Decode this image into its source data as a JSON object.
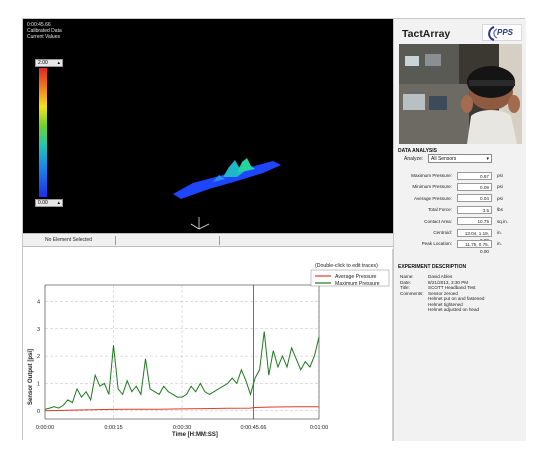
{
  "view3d": {
    "info_lines": [
      "0:00:45.66",
      "Calibrated Data",
      "Current Values"
    ],
    "scale_max": "2.00",
    "scale_min": "0.00"
  },
  "statusbar": {
    "selection": "No Element Selected"
  },
  "graph": {
    "edit_hint": "(Double-click to edit traces)",
    "legend": [
      {
        "name": "Average Pressure",
        "color": "#e03a2e"
      },
      {
        "name": "Maximum Pressure",
        "color": "#1e7a1e"
      }
    ],
    "y_label": "Sensor Output [psi]",
    "x_label": "Time [H:MM:SS]",
    "y_ticks": [
      "0",
      "1",
      "2",
      "3",
      "4"
    ],
    "x_ticks": [
      "0:00:00",
      "0:00:15",
      "0:00:30",
      "0:00:45.66",
      "0:01:00"
    ]
  },
  "chart_data": {
    "type": "line",
    "xlabel": "Time [H:MM:SS]",
    "ylabel": "Sensor Output [psi]",
    "xlim": [
      0,
      60
    ],
    "ylim": [
      -0.3,
      4.6
    ],
    "cursor_x": 45.66,
    "x_ticks": [
      0,
      15,
      30,
      45.66,
      60
    ],
    "y_ticks": [
      0,
      1,
      2,
      3,
      4
    ],
    "grid": true,
    "legend_position": "top-right",
    "series": [
      {
        "name": "Average Pressure",
        "color": "#e03a2e",
        "x": [
          0,
          5,
          10,
          15,
          20,
          25,
          30,
          35,
          40,
          45,
          46,
          50,
          55,
          60
        ],
        "y": [
          0,
          0.02,
          0.04,
          0.05,
          0.06,
          0.06,
          0.07,
          0.08,
          0.09,
          0.1,
          0.12,
          0.14,
          0.15,
          0.15
        ]
      },
      {
        "name": "Maximum Pressure",
        "color": "#1e7a1e",
        "x": [
          0,
          1,
          2,
          3,
          4,
          5,
          6,
          7,
          8,
          9,
          10,
          11,
          12,
          13,
          14,
          15,
          16,
          17,
          18,
          19,
          20,
          21,
          22,
          23,
          24,
          25,
          26,
          27,
          28,
          29,
          30,
          31,
          32,
          33,
          34,
          35,
          36,
          37,
          38,
          39,
          40,
          41,
          42,
          43,
          44,
          45,
          46,
          47,
          48,
          49,
          50,
          51,
          52,
          53,
          54,
          55,
          56,
          57,
          58,
          59,
          60
        ],
        "y": [
          0.05,
          0.1,
          0.15,
          0.1,
          0.2,
          0.4,
          0.3,
          0.8,
          0.5,
          0.7,
          0.4,
          1.3,
          0.9,
          1.0,
          0.6,
          2.4,
          0.8,
          0.6,
          1.1,
          0.7,
          0.9,
          0.6,
          1.9,
          0.8,
          0.7,
          0.6,
          0.9,
          0.7,
          0.6,
          0.5,
          0.5,
          0.6,
          0.9,
          0.7,
          1.0,
          0.7,
          0.6,
          0.7,
          0.8,
          0.9,
          1.0,
          1.2,
          1.0,
          1.5,
          1.1,
          0.6,
          1.2,
          1.5,
          2.9,
          1.3,
          2.2,
          1.6,
          2.0,
          1.6,
          2.3,
          1.9,
          1.5,
          1.8,
          1.6,
          2.0,
          2.7
        ]
      }
    ]
  },
  "right": {
    "brand": "TactArray",
    "logo_text": "PPS",
    "data_analysis_title": "DATA ANALYSIS",
    "analyze_label": "Analyze:",
    "analyze_value": "All Sensors",
    "metrics": [
      {
        "label": "Maximum Pressure:",
        "value": "0.67",
        "unit": "psi"
      },
      {
        "label": "Minimum Pressure:",
        "value": "0.09",
        "unit": "psi"
      },
      {
        "label": "Average Pressure:",
        "value": "0.04",
        "unit": "psi"
      },
      {
        "label": "Total Force:",
        "value": "3.5",
        "unit": "lbs"
      },
      {
        "label": "Contact Area:",
        "value": "10.75",
        "unit": "sq.in."
      },
      {
        "label": "Centroid:",
        "value": "13.04, 1.19, 0.00",
        "unit": "in."
      },
      {
        "label": "Peak Location:",
        "value": "11.75, 0.75, 0.00",
        "unit": "in."
      }
    ],
    "experiment": {
      "title": "EXPERIMENT DESCRIPTION",
      "rows": [
        {
          "k": "Name:",
          "v": "David Ables"
        },
        {
          "k": "Date:",
          "v": "8/21/2013, 3:30 PM"
        },
        {
          "k": "Title:",
          "v": "SCOTT Headband Test"
        },
        {
          "k": "Comments:",
          "v": "Sensor zeroed"
        }
      ],
      "extra_comments": [
        "Helmet put on and fastened",
        "Helmet tightened",
        "Helmet adjusted on head"
      ]
    }
  }
}
